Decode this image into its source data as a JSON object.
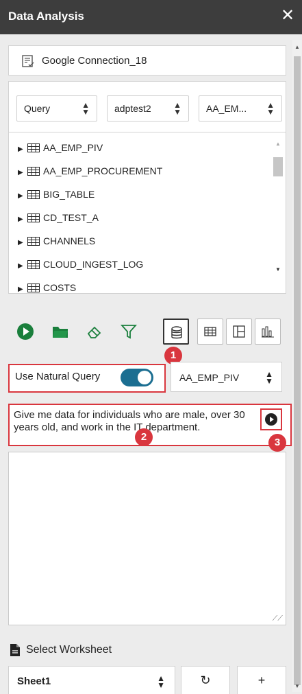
{
  "window": {
    "title": "Data Analysis",
    "close_glyph": "✕"
  },
  "connection": {
    "label": "Google Connection_18",
    "icon": "connection-doc-icon"
  },
  "selectors": {
    "mode": "Query",
    "schema": "adptest2",
    "table": "AA_EM..."
  },
  "tables": [
    "AA_EMP_PIV",
    "AA_EMP_PROCUREMENT",
    "BIG_TABLE",
    "CD_TEST_A",
    "CHANNELS",
    "CLOUD_INGEST_LOG",
    "COSTS"
  ],
  "toolbar": {
    "icons": [
      "run-icon",
      "open-folder-icon",
      "eraser-icon",
      "filter-icon"
    ],
    "views": [
      "database-view-icon",
      "table-view-icon",
      "layout-view-icon",
      "chart-view-icon"
    ],
    "active_view": "database-view-icon",
    "accent": "#1a7f3c"
  },
  "natural_query": {
    "label": "Use Natural Query",
    "enabled": true,
    "table": "AA_EMP_PIV",
    "text": "Give me data for individuals who are male, over 30 years old, and work in the IT department.",
    "toggle_color": "#1b6e91"
  },
  "annotations": [
    "1",
    "2",
    "3"
  ],
  "annotation_color": "#d9363e",
  "worksheet": {
    "label": "Select Worksheet",
    "sheet": "Sheet1",
    "refresh_glyph": "↻",
    "add_glyph": "+"
  }
}
